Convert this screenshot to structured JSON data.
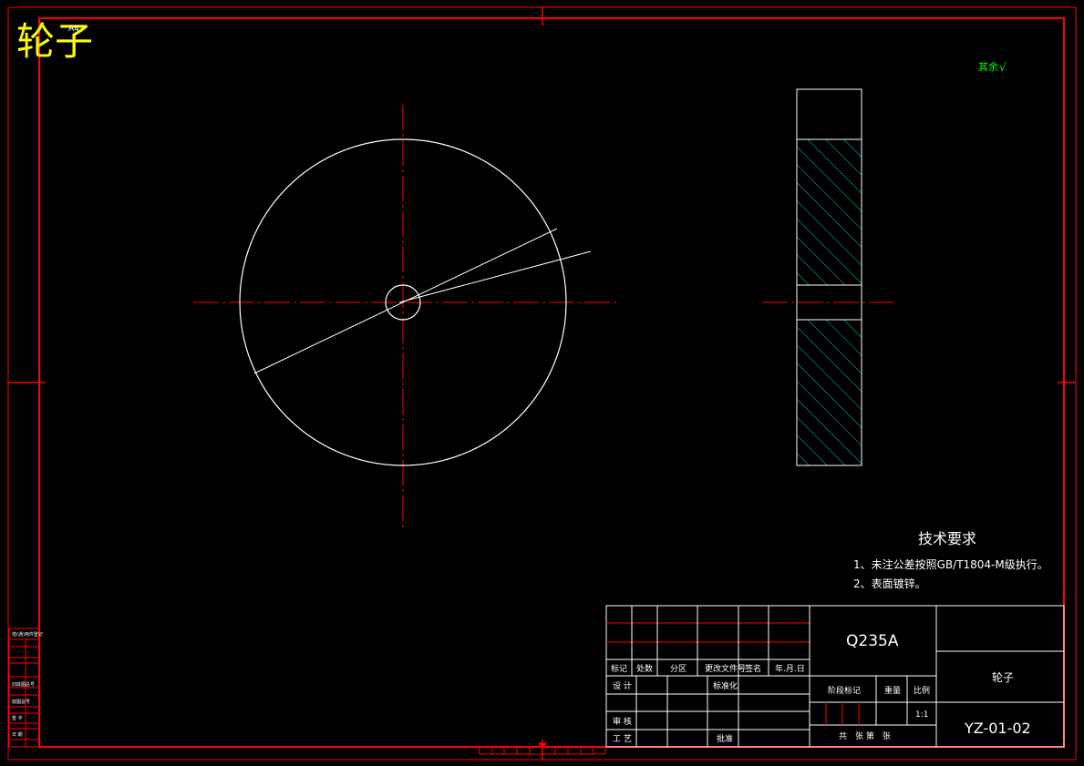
{
  "drawing": {
    "title": "轮子",
    "sheet_size": "A4",
    "roughness_note": "其余",
    "roughness_symbol": "√"
  },
  "tech_requirements": {
    "heading": "技术要求",
    "items": [
      "1、未注公差按照GB/T1804-M级执行。",
      "2、表面镀锌。"
    ]
  },
  "title_block": {
    "material": "Q235A",
    "part_name": "轮子",
    "drawing_number": "YZ-01-02",
    "scale_label": "比例",
    "scale_value": "1:1",
    "weight_label": "重量",
    "stage_label": "阶段标记",
    "sheets_label": "共　张 第　张",
    "change_headers": [
      "标记",
      "处数",
      "分区",
      "更改文件号",
      "签名",
      "年.月.日"
    ],
    "design": "设 计",
    "standardize": "标准化",
    "review": "审 核",
    "process": "工 艺",
    "approve": "批准"
  },
  "side_stamps": [
    "借(通)用件登记",
    "旧底图总号",
    "底图总号",
    "签 字",
    "日 期"
  ],
  "colors": {
    "frame": "#ff0000",
    "outline": "#ffffff",
    "centerline": "#ff0000",
    "hatch": "#00c8c8",
    "title": "#ffff00",
    "roughness": "#00ff00"
  }
}
